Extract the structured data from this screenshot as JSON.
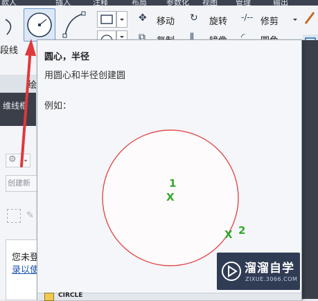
{
  "ribbon": {
    "tab_fragments": [
      "款人",
      "插入",
      "注释",
      "布局",
      "参数化",
      "视图",
      "管理",
      "输出"
    ],
    "left_label": "段线",
    "commands": {
      "move": "移动",
      "rotate": "旋转",
      "trim": "修剪",
      "copy": "复制",
      "mirror": "镜像",
      "fillet": "圆角"
    }
  },
  "left_panel": {
    "top_text": "绘",
    "dark_text": "维线框",
    "input_text": "创建新",
    "box_line1": "您未登",
    "box_line2": "录以使"
  },
  "tooltip": {
    "title": "圆心，半径",
    "description": "用圆心和半径创建圆",
    "example_label": "例如：",
    "bottom_text": "CIRCLE"
  },
  "illustration": {
    "point1_label": "1",
    "point2_label": "2",
    "marker": "X",
    "circle_color": "#e34b4b",
    "marker_color": "#33a829"
  },
  "watermark": {
    "title": "溜溜自学",
    "subtitle": "ZIXUE.3066.COM"
  },
  "colors": {
    "arrow": "#e0383c"
  }
}
